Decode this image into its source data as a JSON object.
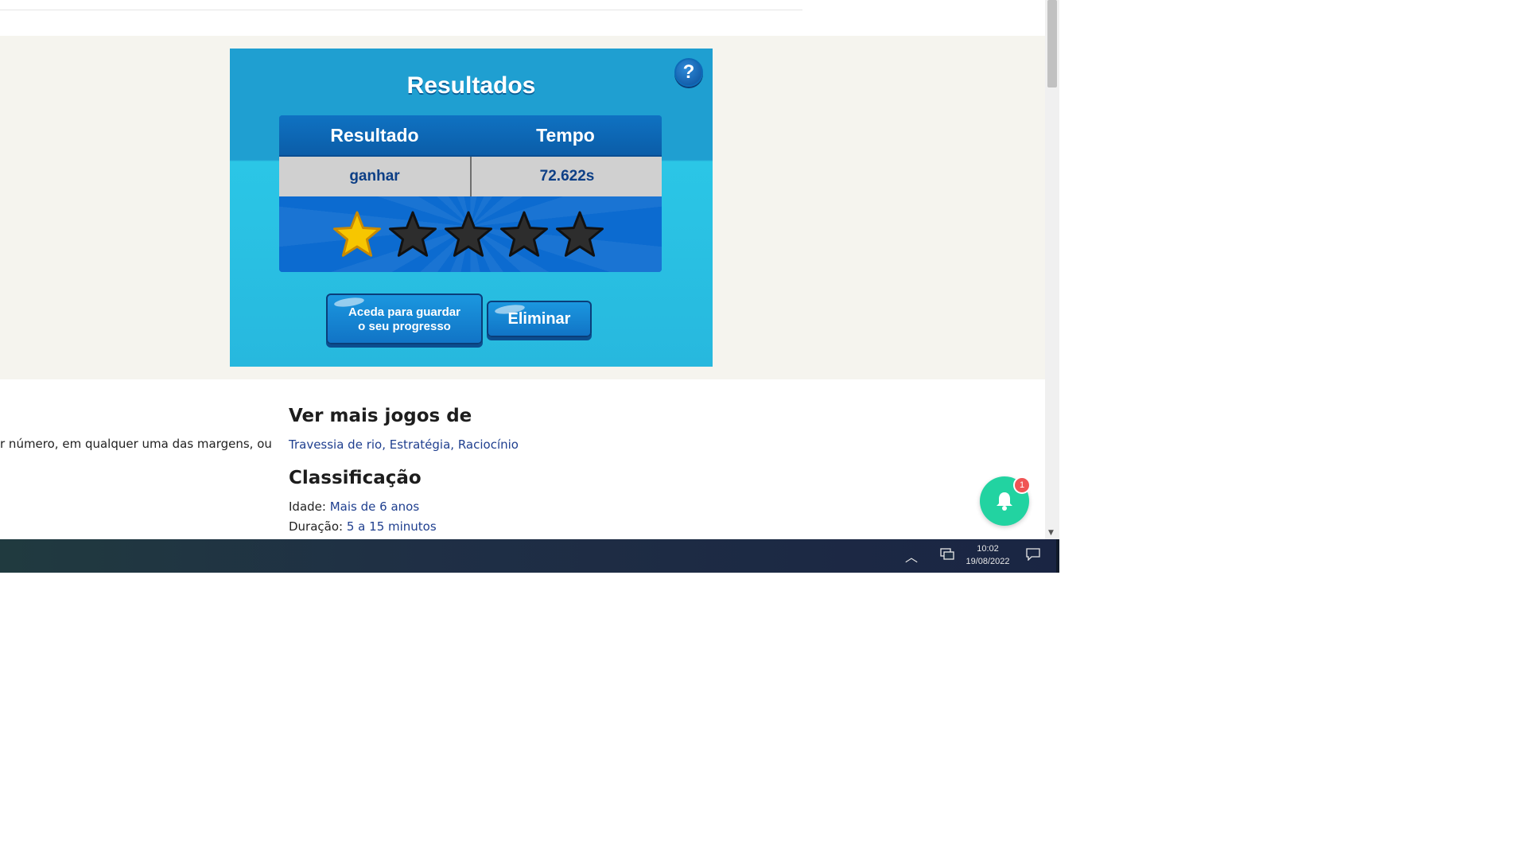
{
  "game": {
    "title": "Resultados",
    "help_label": "?",
    "table": {
      "headers": [
        "Resultado",
        "Tempo"
      ],
      "values": [
        "ganhar",
        "72.622s"
      ]
    },
    "rating": {
      "filled": 1,
      "total": 5
    },
    "buttons": {
      "login_line1": "Aceda para guardar",
      "login_line2": "o seu progresso",
      "delete": "Eliminar"
    }
  },
  "description": {
    "partial_text": "r número, em qualquer uma das margens, ou"
  },
  "more_games": {
    "heading": "Ver mais jogos de",
    "links": [
      "Travessia de rio",
      "Estratégia",
      "Raciocínio"
    ]
  },
  "classification": {
    "heading": "Classificação",
    "age_label": "Idade:",
    "age_value": "Mais de 6 anos",
    "duration_label": "Duração:",
    "duration_value": "5 a 15 minutos"
  },
  "notification": {
    "badge_count": "1",
    "icon": "bell-icon"
  },
  "taskbar": {
    "time": "10:02",
    "date": "19/08/2022"
  },
  "colors": {
    "game_blue": "#1f9fd1",
    "panel_blue": "#0b6ac6",
    "star_gold": "#f7c600",
    "star_dark": "#2d2d2d",
    "link_blue": "#1f3f8f",
    "bell_green": "#22d3a1"
  }
}
